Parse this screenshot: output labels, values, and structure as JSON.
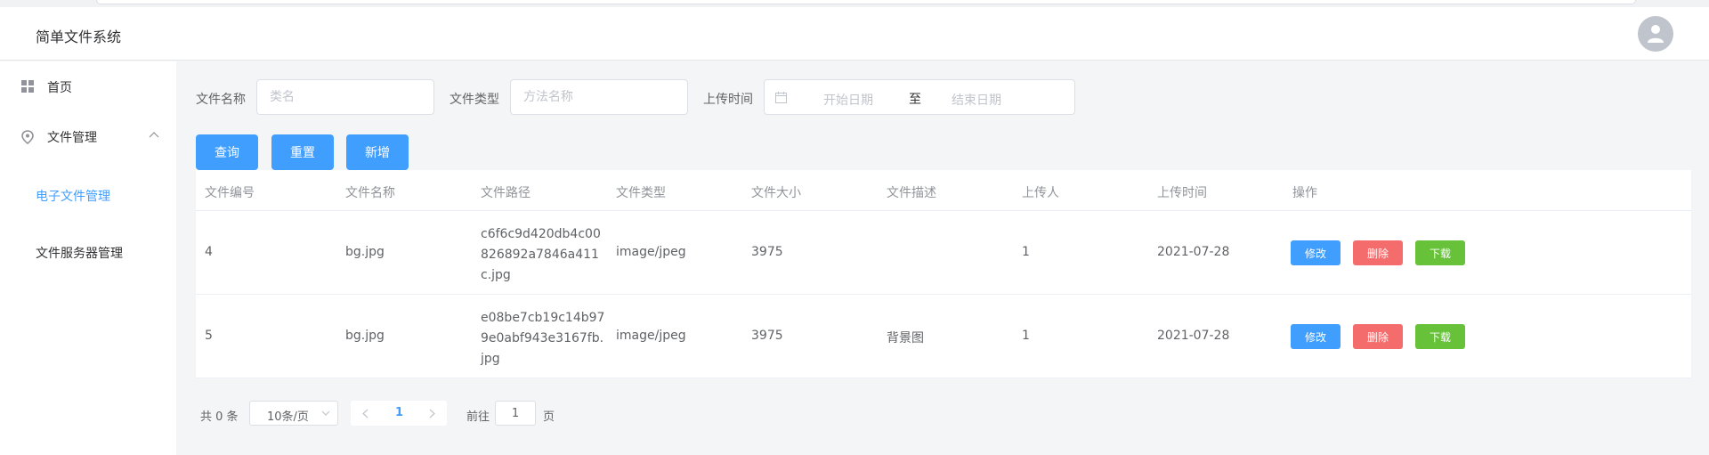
{
  "app": {
    "title": "简单文件系统"
  },
  "sidebar": {
    "home": "首页",
    "file_management": "文件管理",
    "sub_items": [
      "电子文件管理",
      "文件服务器管理"
    ]
  },
  "filters": {
    "name_label": "文件名称",
    "name_placeholder": "类名",
    "type_label": "文件类型",
    "type_placeholder": "方法名称",
    "time_label": "上传时间",
    "start_placeholder": "开始日期",
    "range_separator": "至",
    "end_placeholder": "结束日期"
  },
  "buttons": {
    "query": "查询",
    "reset": "重置",
    "add": "新增"
  },
  "table": {
    "headers": [
      "文件编号",
      "文件名称",
      "文件路径",
      "文件类型",
      "文件大小",
      "文件描述",
      "上传人",
      "上传时间",
      "操作"
    ],
    "rows": [
      {
        "id": "4",
        "name": "bg.jpg",
        "path": "c6f6c9d420db4c00826892a7846a411c.jpg",
        "type": "image/jpeg",
        "size": "3975",
        "desc": "",
        "uploader": "1",
        "time": "2021-07-28"
      },
      {
        "id": "5",
        "name": "bg.jpg",
        "path": "e08be7cb19c14b979e0abf943e3167fb.jpg",
        "type": "image/jpeg",
        "size": "3975",
        "desc": "背景图",
        "uploader": "1",
        "time": "2021-07-28"
      }
    ],
    "actions": {
      "edit": "修改",
      "delete": "删除",
      "download": "下载"
    }
  },
  "pagination": {
    "total": "共 0 条",
    "page_size": "10条/页",
    "current": "1",
    "goto_label": "前往",
    "goto_value": "1",
    "page_suffix": "页"
  },
  "colors": {
    "primary": "#409eff",
    "danger": "#f56c6c",
    "success": "#67c23a"
  }
}
